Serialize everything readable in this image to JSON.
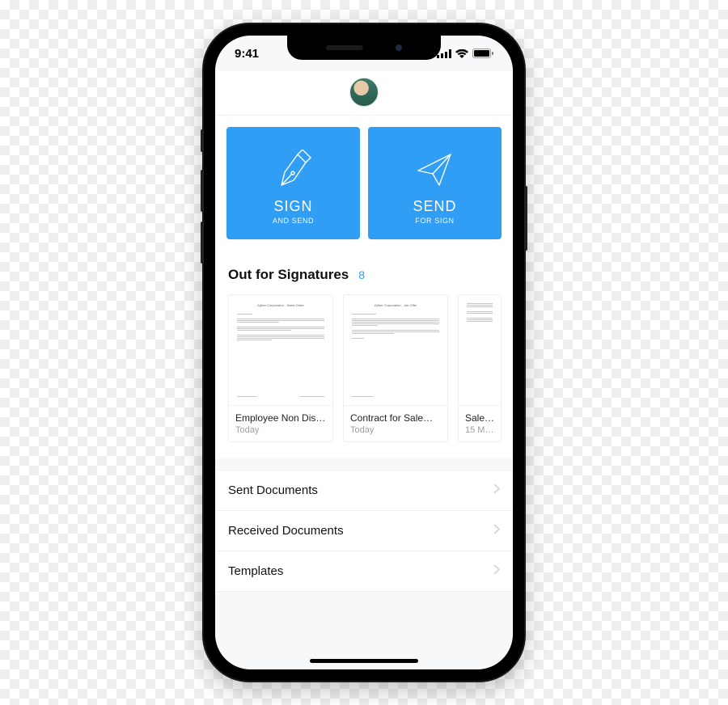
{
  "status": {
    "time": "9:41"
  },
  "actions": {
    "sign": {
      "title": "SIGN",
      "subtitle": "AND SEND"
    },
    "send": {
      "title": "SEND",
      "subtitle": "FOR SIGN"
    }
  },
  "out_for_sig": {
    "title": "Out for Signatures",
    "count": "8",
    "docs": [
      {
        "preview_title": "Zylker Corporation - Sales Order",
        "title": "Employee Non Dis…",
        "date": "Today"
      },
      {
        "preview_title": "Zylker Corporation - Job Offer",
        "title": "Contract for Sale…",
        "date": "Today"
      },
      {
        "preview_title": "",
        "title": "Sale…",
        "date": "15 M…"
      }
    ]
  },
  "nav": {
    "sent": "Sent Documents",
    "received": "Received Documents",
    "templates": "Templates"
  }
}
